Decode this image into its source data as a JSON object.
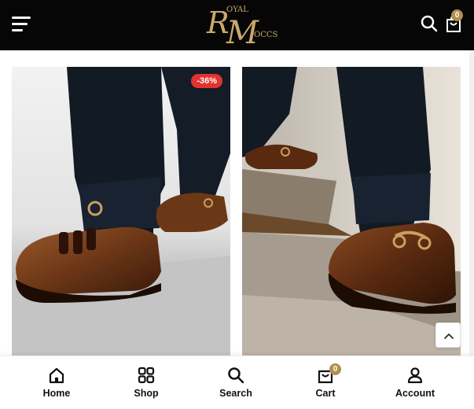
{
  "header": {
    "logo_word_top": "OYAL",
    "logo_word_bottom": "OCCS",
    "logo_initials": "RM",
    "cart_count": "0"
  },
  "products": [
    {
      "sale_badge": "-36%"
    },
    {
      "sale_badge": ""
    }
  ],
  "bottom_nav": {
    "items": [
      {
        "label": "Home",
        "icon": "home-icon"
      },
      {
        "label": "Shop",
        "icon": "grid-icon"
      },
      {
        "label": "Search",
        "icon": "search-icon"
      },
      {
        "label": "Cart",
        "icon": "bag-icon"
      },
      {
        "label": "Account",
        "icon": "user-icon"
      }
    ],
    "cart_count": "0"
  },
  "colors": {
    "header_bg": "#060606",
    "accent_gold": "#b08f4f",
    "sale_red": "#e2332f"
  }
}
